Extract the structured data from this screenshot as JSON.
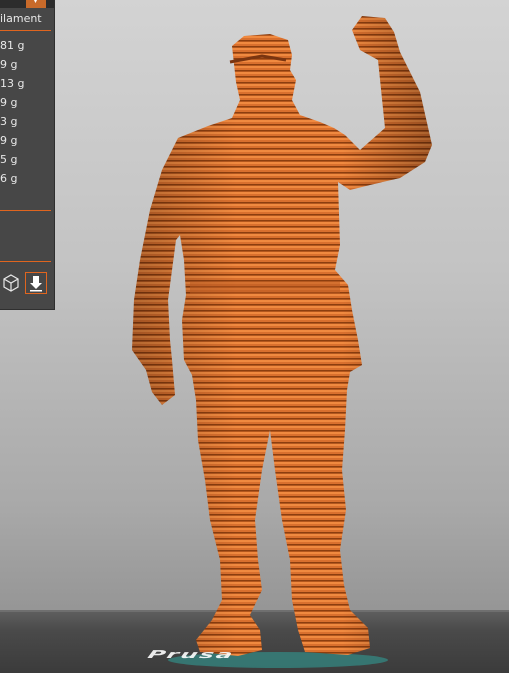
{
  "panel": {
    "header": "ilament",
    "rows": [
      {
        "text": "81 g"
      },
      {
        "text": "9 g"
      },
      {
        "text": "13 g"
      },
      {
        "text": "9 g"
      },
      {
        "text": "3 g"
      },
      {
        "text": "9 g"
      },
      {
        "text": "5 g"
      },
      {
        "text": "6 g"
      }
    ],
    "top_button": "▾"
  },
  "icons": {
    "view": "cube-wireframe-icon",
    "export": "download-arrow-icon"
  },
  "colors": {
    "model": "#d9702e",
    "accent": "#e0651f",
    "panel": "#474747"
  },
  "bed_logo": "Prusa"
}
